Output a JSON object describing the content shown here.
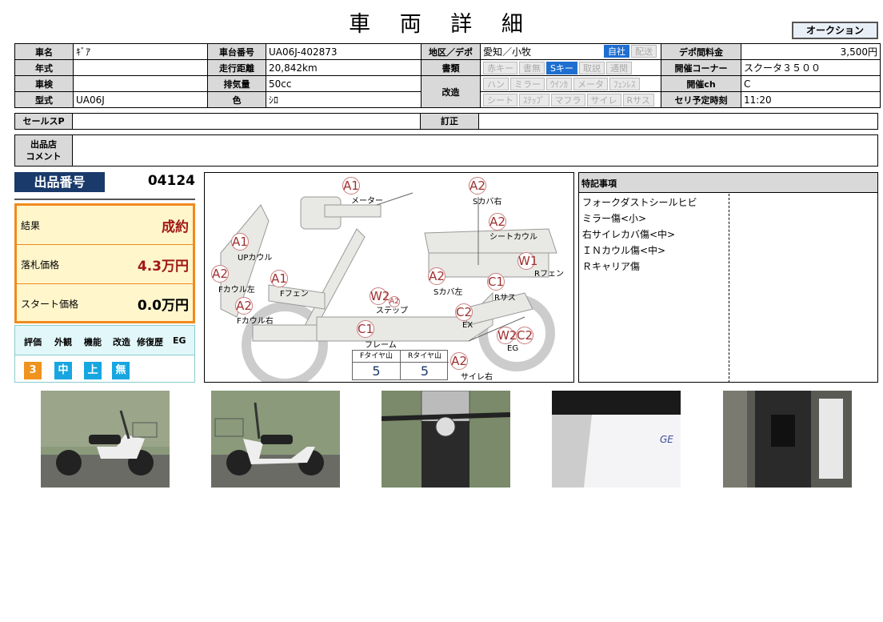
{
  "page_title": "車 両 詳 細",
  "auction_button": "オークション",
  "fields": {
    "name_label": "車名",
    "name": "ｷﾞｱ",
    "year_label": "年式",
    "year": "",
    "inspection_label": "車検",
    "inspection": "",
    "model_label": "型式",
    "model": "UA06J",
    "frame_label": "車台番号",
    "frame": "UA06J-402873",
    "mileage_label": "走行距離",
    "mileage": "20,842km",
    "displacement_label": "排気量",
    "displacement": "50cc",
    "color_label": "色",
    "color": "ｼﾛ",
    "region_label": "地区／デポ",
    "region": "愛知／小牧",
    "docs_label": "書類",
    "mod_label": "改造",
    "fee_label": "デポ間料金",
    "fee": "3,500円",
    "corner_label": "開催コーナー",
    "corner": "スクータ３５００",
    "channel_label": "開催ch",
    "channel": "C",
    "time_label": "セリ予定時刻",
    "time": "11:20",
    "salespoint_label": "セールスP",
    "salespoint": "",
    "correction_label": "訂正",
    "correction": "",
    "comment_label": "出品店\nコメント",
    "comment": ""
  },
  "region_tags": [
    {
      "label": "自社",
      "on": true
    },
    {
      "label": "配送",
      "on": false
    }
  ],
  "doc_tags": [
    {
      "label": "赤キー",
      "on": false
    },
    {
      "label": "書無",
      "on": false
    },
    {
      "label": "Sキー",
      "on": true
    },
    {
      "label": "取説",
      "on": false
    },
    {
      "label": "通関",
      "on": false
    }
  ],
  "mod_tags_row1": [
    {
      "label": "ハン",
      "on": false
    },
    {
      "label": "ミラー",
      "on": false
    },
    {
      "label": "ｳｲﾝｶ",
      "on": false
    },
    {
      "label": "メータ",
      "on": false
    },
    {
      "label": "ﾌｪﾝﾚｽ",
      "on": false
    }
  ],
  "mod_tags_row2": [
    {
      "label": "シート",
      "on": false
    },
    {
      "label": "ｽﾃｯﾌﾟ",
      "on": false
    },
    {
      "label": "マフラ",
      "on": false
    },
    {
      "label": "サイレ",
      "on": false
    },
    {
      "label": "Rサス",
      "on": false
    }
  ],
  "lot": {
    "label": "出品番号",
    "number": "04124"
  },
  "result": {
    "result_label": "結果",
    "result_value": "成約",
    "bid_label": "落札価格",
    "bid_value": "4.3万円",
    "start_label": "スタート価格",
    "start_value": "0.0万円"
  },
  "eval_headers": [
    "評価",
    "外観",
    "機能",
    "改造",
    "修復歴",
    "EG"
  ],
  "eval_values": [
    {
      "value": "3",
      "color": "#f0921e"
    },
    {
      "value": "中",
      "color": "#17a6e0"
    },
    {
      "value": "上",
      "color": "#17a6e0"
    },
    {
      "value": "無",
      "color": "#17a6e0"
    }
  ],
  "damage_marks": [
    {
      "code": "A1",
      "part": "メーター"
    },
    {
      "code": "A2",
      "part": "Sカバ右"
    },
    {
      "code": "A2",
      "part": "シートカウル"
    },
    {
      "code": "A1",
      "part": "UPカウル"
    },
    {
      "code": "A2",
      "part": "Fカウル左"
    },
    {
      "code": "A1",
      "part": "Fフェン"
    },
    {
      "code": "A2",
      "part": "Fカウル右"
    },
    {
      "code": "W2",
      "code2": "A2",
      "part": "ステップ"
    },
    {
      "code": "A2",
      "part": "Sカバ左"
    },
    {
      "code": "W1",
      "part": "Rフェン"
    },
    {
      "code": "C1",
      "part": "Rサス"
    },
    {
      "code": "C2",
      "part": "EX"
    },
    {
      "code": "W2",
      "code2": "C2",
      "part": "EG"
    },
    {
      "code": "C1",
      "part": "フレーム"
    },
    {
      "code": "A2",
      "part": "サイレ右"
    }
  ],
  "tires": {
    "front_label": "Fタイヤ山",
    "front": "5",
    "rear_label": "Rタイヤ山",
    "rear": "5"
  },
  "notes": {
    "header": "特記事項",
    "items": [
      "フォークダストシールヒビ",
      "ミラー傷<小>",
      "右サイレカバ傷<中>",
      "ＩＮカウル傷<中>",
      "Ｒキャリア傷"
    ]
  },
  "photos": [
    "scooter-left-side",
    "scooter-right-side",
    "handlebar-front",
    "cowl-closeup",
    "floorboard-closeup"
  ]
}
